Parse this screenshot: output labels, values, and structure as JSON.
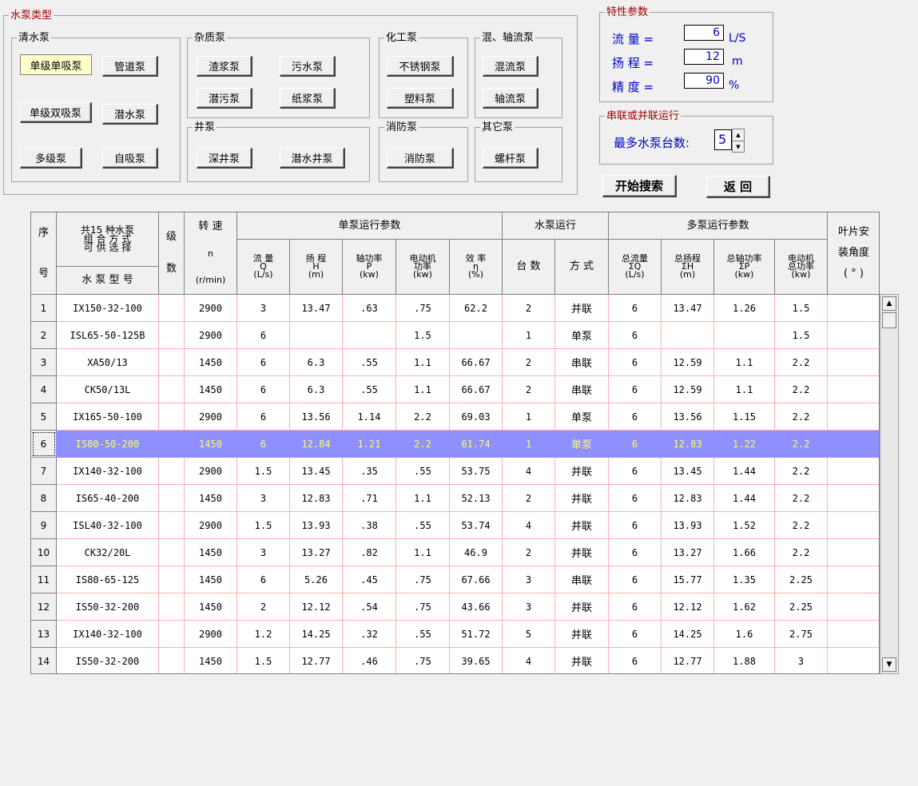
{
  "pump_types": {
    "title": "水泵类型",
    "groups": {
      "clear": {
        "label": "清水泵",
        "buttons": [
          "单级单吸泵",
          "管道泵",
          "单级双吸泵",
          "潜水泵",
          "多级泵",
          "自吸泵"
        ]
      },
      "impurity": {
        "label": "杂质泵",
        "buttons": [
          "渣浆泵",
          "污水泵",
          "潜污泵",
          "纸浆泵"
        ]
      },
      "well": {
        "label": "井泵",
        "buttons": [
          "深井泵",
          "潜水井泵"
        ]
      },
      "chemical": {
        "label": "化工泵",
        "buttons": [
          "不锈钢泵",
          "塑料泵"
        ]
      },
      "mixed": {
        "label": "混、轴流泵",
        "buttons": [
          "混流泵",
          "轴流泵"
        ]
      },
      "fire": {
        "label": "消防泵",
        "buttons": [
          "消防泵"
        ]
      },
      "other": {
        "label": "其它泵",
        "buttons": [
          "螺杆泵"
        ]
      }
    }
  },
  "params": {
    "title": "特性参数",
    "flow": {
      "label": "流  量 =",
      "value": "6",
      "unit": "L/S"
    },
    "head": {
      "label": "扬  程 =",
      "value": "12",
      "unit": "m"
    },
    "precision": {
      "label": "精  度 =",
      "value": "90",
      "unit": "%"
    }
  },
  "series": {
    "title": "串联或并联运行",
    "label": "最多水泵台数:",
    "value": "5"
  },
  "actions": {
    "search": "开始搜索",
    "back": "返  回"
  },
  "table": {
    "headers": {
      "seq_top": "序",
      "seq_bottom": "号",
      "combo": "共15 种水泵\n组 合 方 式\n可 供 选 择",
      "model": "水 泵 型 号",
      "stage_top": "级",
      "stage_bottom": "数",
      "speed": "转  速",
      "speed_sym": "n",
      "speed_unit": "(r/min)",
      "single": "单泵运行参数",
      "flow": "流  量\nQ\n(L/s)",
      "head": "扬  程\nH\n(m)",
      "shaft": "轴功率\nP\n(kw)",
      "motor": "电动机\n功率\n(kw)",
      "eff": "效  率\nη\n(%)",
      "run": "水泵运行",
      "count": "台  数",
      "mode": "方  式",
      "multi": "多泵运行参数",
      "tflow": "总流量\nΣQ\n(L/s)",
      "thead": "总扬程\nΣH\n(m)",
      "tshaft": "总轴功率\nΣP\n(kw)",
      "tmotor": "电动机\n总功率\n(kw)",
      "angle": "叶片安\n装角度\n( ° )"
    },
    "selected_row": 5,
    "rows": [
      [
        "1",
        "IX150-32-100",
        "",
        "2900",
        "3",
        "13.47",
        ".63",
        ".75",
        "62.2",
        "2",
        "并联",
        "6",
        "13.47",
        "1.26",
        "1.5",
        ""
      ],
      [
        "2",
        "ISL65-50-125B",
        "",
        "2900",
        "6",
        "",
        "",
        "1.5",
        "",
        "1",
        "单泵",
        "6",
        "",
        "",
        "1.5",
        ""
      ],
      [
        "3",
        "XA50/13",
        "",
        "1450",
        "6",
        "6.3",
        ".55",
        "1.1",
        "66.67",
        "2",
        "串联",
        "6",
        "12.59",
        "1.1",
        "2.2",
        ""
      ],
      [
        "4",
        "CK50/13L",
        "",
        "1450",
        "6",
        "6.3",
        ".55",
        "1.1",
        "66.67",
        "2",
        "串联",
        "6",
        "12.59",
        "1.1",
        "2.2",
        ""
      ],
      [
        "5",
        "IX165-50-100",
        "",
        "2900",
        "6",
        "13.56",
        "1.14",
        "2.2",
        "69.03",
        "1",
        "单泵",
        "6",
        "13.56",
        "1.15",
        "2.2",
        ""
      ],
      [
        "6",
        "IS80-50-200",
        "",
        "1450",
        "6",
        "12.84",
        "1.21",
        "2.2",
        "61.74",
        "1",
        "单泵",
        "6",
        "12.83",
        "1.22",
        "2.2",
        ""
      ],
      [
        "7",
        "IX140-32-100",
        "",
        "2900",
        "1.5",
        "13.45",
        ".35",
        ".55",
        "53.75",
        "4",
        "并联",
        "6",
        "13.45",
        "1.44",
        "2.2",
        ""
      ],
      [
        "8",
        "IS65-40-200",
        "",
        "1450",
        "3",
        "12.83",
        ".71",
        "1.1",
        "52.13",
        "2",
        "并联",
        "6",
        "12.83",
        "1.44",
        "2.2",
        ""
      ],
      [
        "9",
        "ISL40-32-100",
        "",
        "2900",
        "1.5",
        "13.93",
        ".38",
        ".55",
        "53.74",
        "4",
        "并联",
        "6",
        "13.93",
        "1.52",
        "2.2",
        ""
      ],
      [
        "10",
        "CK32/20L",
        "",
        "1450",
        "3",
        "13.27",
        ".82",
        "1.1",
        "46.9",
        "2",
        "并联",
        "6",
        "13.27",
        "1.66",
        "2.2",
        ""
      ],
      [
        "11",
        "IS80-65-125",
        "",
        "1450",
        "6",
        "5.26",
        ".45",
        ".75",
        "67.66",
        "3",
        "串联",
        "6",
        "15.77",
        "1.35",
        "2.25",
        ""
      ],
      [
        "12",
        "IS50-32-200",
        "",
        "1450",
        "2",
        "12.12",
        ".54",
        ".75",
        "43.66",
        "3",
        "并联",
        "6",
        "12.12",
        "1.62",
        "2.25",
        ""
      ],
      [
        "13",
        "IX140-32-100",
        "",
        "2900",
        "1.2",
        "14.25",
        ".32",
        ".55",
        "51.72",
        "5",
        "并联",
        "6",
        "14.25",
        "1.6",
        "2.75",
        ""
      ],
      [
        "14",
        "IS50-32-200",
        "",
        "1450",
        "1.5",
        "12.77",
        ".46",
        ".75",
        "39.65",
        "4",
        "并联",
        "6",
        "12.77",
        "1.88",
        "3",
        ""
      ]
    ]
  }
}
